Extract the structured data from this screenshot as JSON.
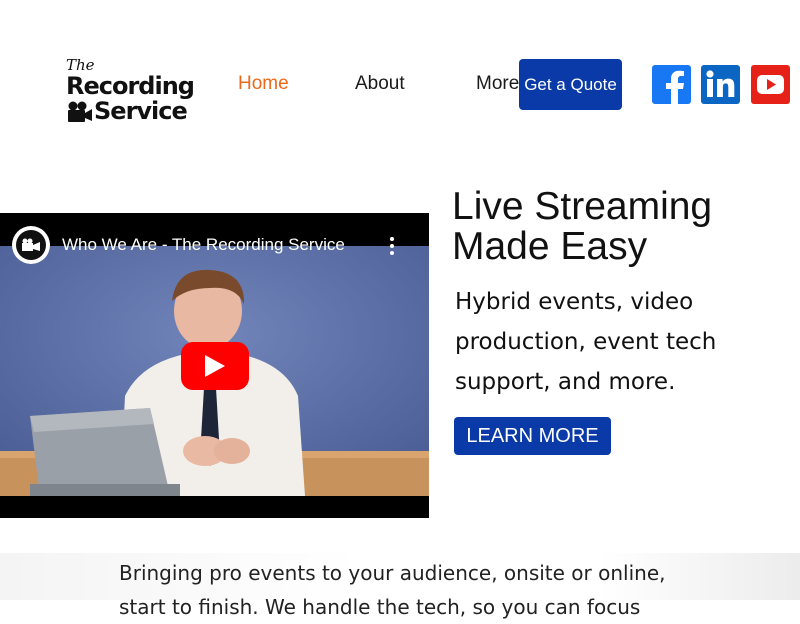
{
  "header": {
    "logo": {
      "the": "The",
      "line1": "Recording",
      "line2": "Service"
    },
    "nav": {
      "home": "Home",
      "about": "About",
      "more": "More"
    },
    "quote_label": "Get a Quote",
    "social": [
      "facebook-icon",
      "linkedin-icon",
      "youtube-icon"
    ]
  },
  "video": {
    "title": "Who We Are - The Recording Service"
  },
  "hero": {
    "title_line1": "Live Streaming",
    "title_line2": "Made Easy",
    "subtitle": "Hybrid events, video production, event tech support, and more.",
    "button_label": "LEARN MORE"
  },
  "band": {
    "line1": "Bringing pro events to your audience, onsite or online,",
    "line2": "start to finish. We handle the tech, so you can focus"
  },
  "colors": {
    "accent_nav": "#e86a1a",
    "brand_blue": "#0a3aa8",
    "facebook": "#1877f2",
    "linkedin": "#0a66c2",
    "youtube": "#e62117"
  }
}
